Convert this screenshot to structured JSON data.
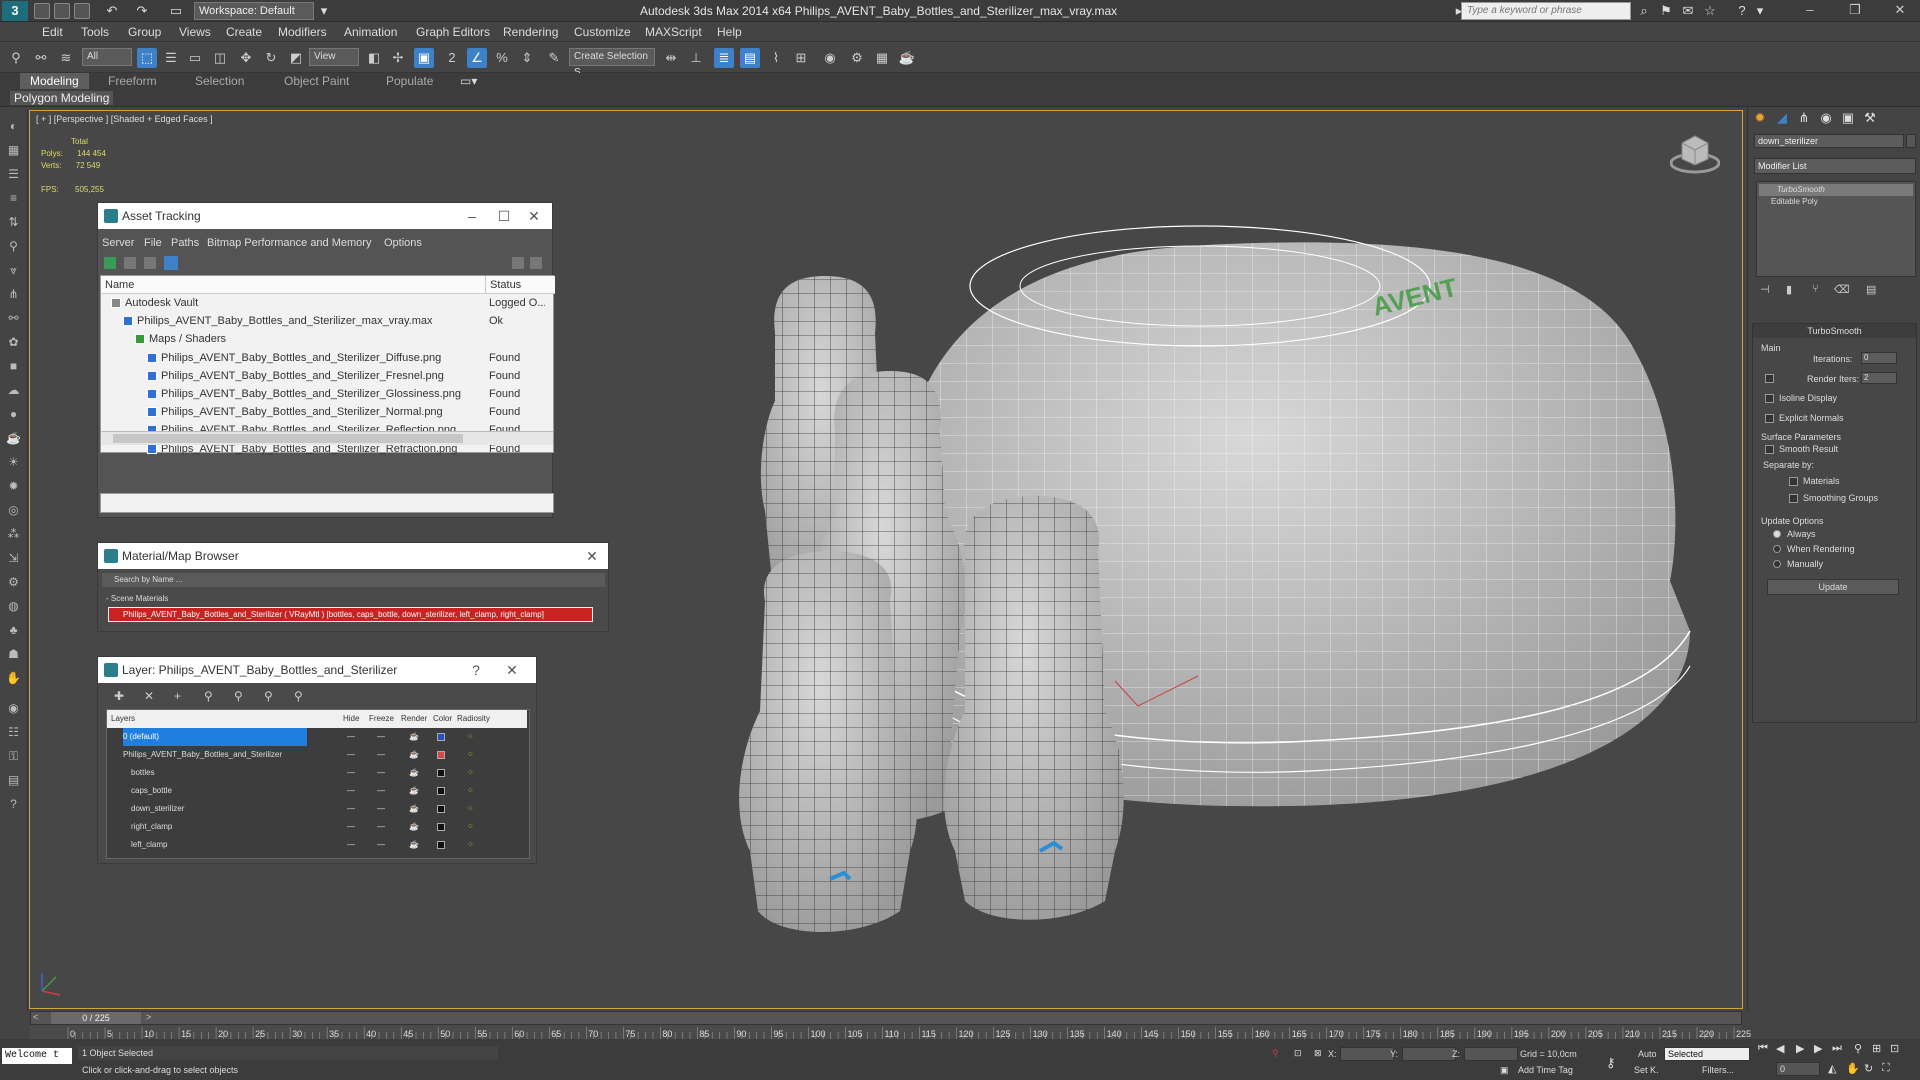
{
  "titlebar": {
    "workspace": "Workspace: Default",
    "title": "Autodesk 3ds Max  2014 x64    Philips_AVENT_Baby_Bottles_and_Sterilizer_max_vray.max",
    "search_placeholder": "Type a keyword or phrase"
  },
  "menu": [
    "Edit",
    "Tools",
    "Group",
    "Views",
    "Create",
    "Modifiers",
    "Animation",
    "Graph Editors",
    "Rendering",
    "Customize",
    "MAXScript",
    "Help"
  ],
  "toolbar": {
    "selection_filter": "All",
    "ref_coord": "View",
    "named_selection": "Create Selection S"
  },
  "ribbon": {
    "tabs": [
      "Modeling",
      "Freeform",
      "Selection",
      "Object Paint",
      "Populate"
    ],
    "active_tab": "Modeling",
    "panel_label": "Polygon Modeling"
  },
  "viewport": {
    "label": "[ + ] [Perspective ] [Shaded + Edged Faces ]",
    "stats": {
      "total_label": "Total",
      "polys_label": "Polys:",
      "polys_value": "144 454",
      "verts_label": "Verts:",
      "verts_value": "72 549",
      "fps_label": "FPS:",
      "fps_value": "505,255"
    },
    "logo_text": "AVENT"
  },
  "asset_tracking": {
    "title": "Asset Tracking",
    "menu": [
      "Server",
      "File",
      "Paths",
      "Bitmap Performance and Memory",
      "Options"
    ],
    "columns": [
      "Name",
      "Status"
    ],
    "rows": [
      {
        "name": "Autodesk Vault",
        "status": "Logged O..."
      },
      {
        "name": "Philips_AVENT_Baby_Bottles_and_Sterilizer_max_vray.max",
        "status": "Ok"
      },
      {
        "name": "Maps / Shaders",
        "status": ""
      },
      {
        "name": "Philips_AVENT_Baby_Bottles_and_Sterilizer_Diffuse.png",
        "status": "Found"
      },
      {
        "name": "Philips_AVENT_Baby_Bottles_and_Sterilizer_Fresnel.png",
        "status": "Found"
      },
      {
        "name": "Philips_AVENT_Baby_Bottles_and_Sterilizer_Glossiness.png",
        "status": "Found"
      },
      {
        "name": "Philips_AVENT_Baby_Bottles_and_Sterilizer_Normal.png",
        "status": "Found"
      },
      {
        "name": "Philips_AVENT_Baby_Bottles_and_Sterilizer_Reflection.png",
        "status": "Found"
      },
      {
        "name": "Philips_AVENT_Baby_Bottles_and_Sterilizer_Refraction.png",
        "status": "Found"
      }
    ]
  },
  "material_browser": {
    "title": "Material/Map Browser",
    "search_placeholder": "Search by Name ...",
    "section": "- Scene Materials",
    "material": "Philips_AVENT_Baby_Bottles_and_Sterilizer ( VRayMtl ) [bottles, caps_bottle, down_sterilizer, left_clamp, right_clamp]"
  },
  "layer_dialog": {
    "title": "Layer: Philips_AVENT_Baby_Bottles_and_Sterilizer",
    "help": "?",
    "columns": [
      "Layers",
      "Hide",
      "Freeze",
      "Render",
      "Color",
      "Radiosity"
    ],
    "rows": [
      {
        "name": "0 (default)",
        "indent": 1,
        "color": "#2a4ec2",
        "selected": true
      },
      {
        "name": "Philips_AVENT_Baby_Bottles_and_Sterilizer",
        "indent": 1,
        "color": "#d24b4b",
        "selected": false
      },
      {
        "name": "bottles",
        "indent": 2,
        "color": "#111111",
        "selected": false
      },
      {
        "name": "caps_bottle",
        "indent": 2,
        "color": "#111111",
        "selected": false
      },
      {
        "name": "down_sterilizer",
        "indent": 2,
        "color": "#111111",
        "selected": false
      },
      {
        "name": "right_clamp",
        "indent": 2,
        "color": "#111111",
        "selected": false
      },
      {
        "name": "left_clamp",
        "indent": 2,
        "color": "#111111",
        "selected": false
      }
    ]
  },
  "command_panel": {
    "object_name": "down_sterilizer",
    "modifier_list": "Modifier List",
    "stack": [
      "TurboSmooth",
      "Editable Poly"
    ],
    "rollout_title": "TurboSmooth",
    "main_label": "Main",
    "iterations_label": "Iterations:",
    "iterations_value": "0",
    "render_iters_label": "Render Iters:",
    "render_iters_value": "2",
    "isoline_display": "Isoline Display",
    "explicit_normals": "Explicit Normals",
    "surface_params": "Surface Parameters",
    "smooth_result": "Smooth Result",
    "separate_by": "Separate by:",
    "materials": "Materials",
    "smoothing_groups": "Smoothing Groups",
    "update_options": "Update Options",
    "always": "Always",
    "when_rendering": "When Rendering",
    "manually": "Manually",
    "update_button": "Update"
  },
  "timeline": {
    "frame_counter": "0 / 225",
    "ticks": [
      "0",
      "5",
      "10",
      "15",
      "20",
      "25",
      "30",
      "35",
      "40",
      "45",
      "50",
      "55",
      "60",
      "65",
      "70",
      "75",
      "80",
      "85",
      "90",
      "95",
      "100",
      "105",
      "110",
      "115",
      "120",
      "125",
      "130",
      "135",
      "140",
      "145",
      "150",
      "155",
      "160",
      "165",
      "170",
      "175",
      "180",
      "185",
      "190",
      "195",
      "200",
      "205",
      "210",
      "215",
      "220",
      "225"
    ]
  },
  "status": {
    "maxscript": "Welcome t",
    "selection": "1 Object Selected",
    "prompt": "Click or click-and-drag to select objects",
    "x_label": "X:",
    "y_label": "Y:",
    "z_label": "Z:",
    "grid": "Grid = 10,0cm",
    "auto": "Auto",
    "selected": "Selected",
    "set_key": "Set K.",
    "filters": "Filters...",
    "add_time_tag": "Add Time Tag",
    "frame": "0"
  },
  "colors": {
    "accent": "#3d82c9",
    "viewport_border": "#d9a04a",
    "stats_text": "#dcdc6a"
  }
}
